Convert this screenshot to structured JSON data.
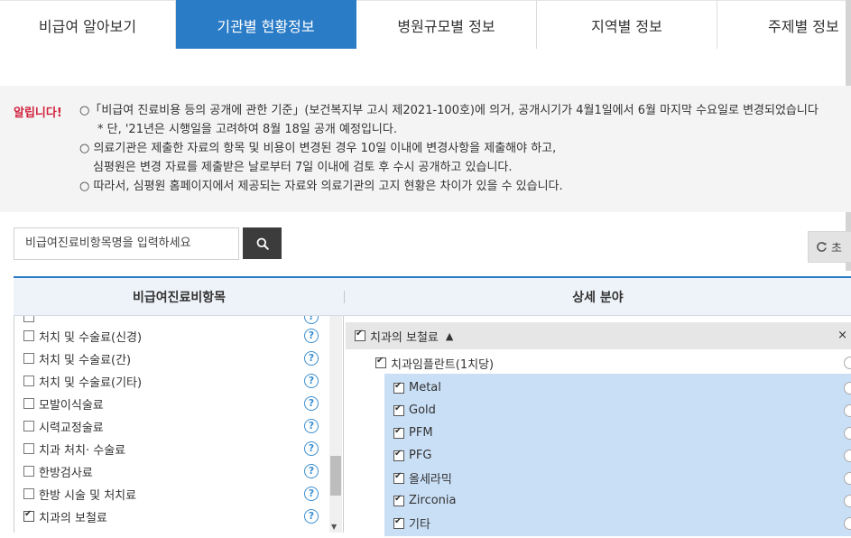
{
  "tabs": [
    {
      "label": "비급여 알아보기",
      "active": false
    },
    {
      "label": "기관별 현황정보",
      "active": true
    },
    {
      "label": "병원규모별 정보",
      "active": false
    },
    {
      "label": "지역별 정보",
      "active": false
    },
    {
      "label": "주제별 정보",
      "active": false
    }
  ],
  "notice": {
    "label": "알립니다!",
    "lines": [
      "○「비급여 진료비용 등의 공개에 관한 기준」(보건복지부 고시 제2021-100호)에 의거, 공개시기가 4월1일에서 6월 마지막 수요일로 변경되었습니다",
      "* 단, '21년은 시행일을 고려하여 8월 18일 공개 예정입니다.",
      "○ 의료기관은 제출한 자료의 항목 및 비용이 변경된 경우 10일 이내에 변경사항을 제출해야 하고,",
      "심평원은 변경 자료를 제출받은 날로부터 7일 이내에 검토 후 수시 공개하고 있습니다.",
      "○ 따라서, 심평원 홈페이지에서 제공되는 자료와 의료기관의 고지 현황은 차이가 있을 수 있습니다."
    ]
  },
  "search": {
    "placeholder": "비급여진료비항목명을 입력하세요",
    "reset_label": "초"
  },
  "table": {
    "left_header": "비급여진료비항목",
    "right_header": "상세 분야",
    "left_items": [
      {
        "label": "처치 및 수술료(신경)",
        "checked": false
      },
      {
        "label": "처치 및 수술료(간)",
        "checked": false
      },
      {
        "label": "처치 및 수술료(기타)",
        "checked": false
      },
      {
        "label": "모발이식술료",
        "checked": false
      },
      {
        "label": "시력교정술료",
        "checked": false
      },
      {
        "label": "치과 처치· 수술료",
        "checked": false
      },
      {
        "label": "한방검사료",
        "checked": false
      },
      {
        "label": "한방 시술 및 처치료",
        "checked": false
      },
      {
        "label": "치과의 보철료",
        "checked": true
      }
    ],
    "help_glyph": "?",
    "category": {
      "label": "치과의 보철료",
      "checked": true,
      "close": "×"
    },
    "subcategory": {
      "label": "치과임플란트(1치당)",
      "checked": true
    },
    "detail_items": [
      {
        "label": "Metal",
        "checked": true
      },
      {
        "label": "Gold",
        "checked": true
      },
      {
        "label": "PFM",
        "checked": true
      },
      {
        "label": "PFG",
        "checked": true
      },
      {
        "label": "올세라믹",
        "checked": true
      },
      {
        "label": "Zirconia",
        "checked": true
      },
      {
        "label": "기타",
        "checked": true
      }
    ]
  },
  "icons": {
    "search": "search-icon",
    "reset": "refresh-icon",
    "collapse": "chevron-up-icon",
    "scroll_down": "arrow-down-icon"
  },
  "colors": {
    "accent": "#2b7cc6",
    "notice_label": "#d1233d",
    "selected_bg": "#c9dff6"
  }
}
